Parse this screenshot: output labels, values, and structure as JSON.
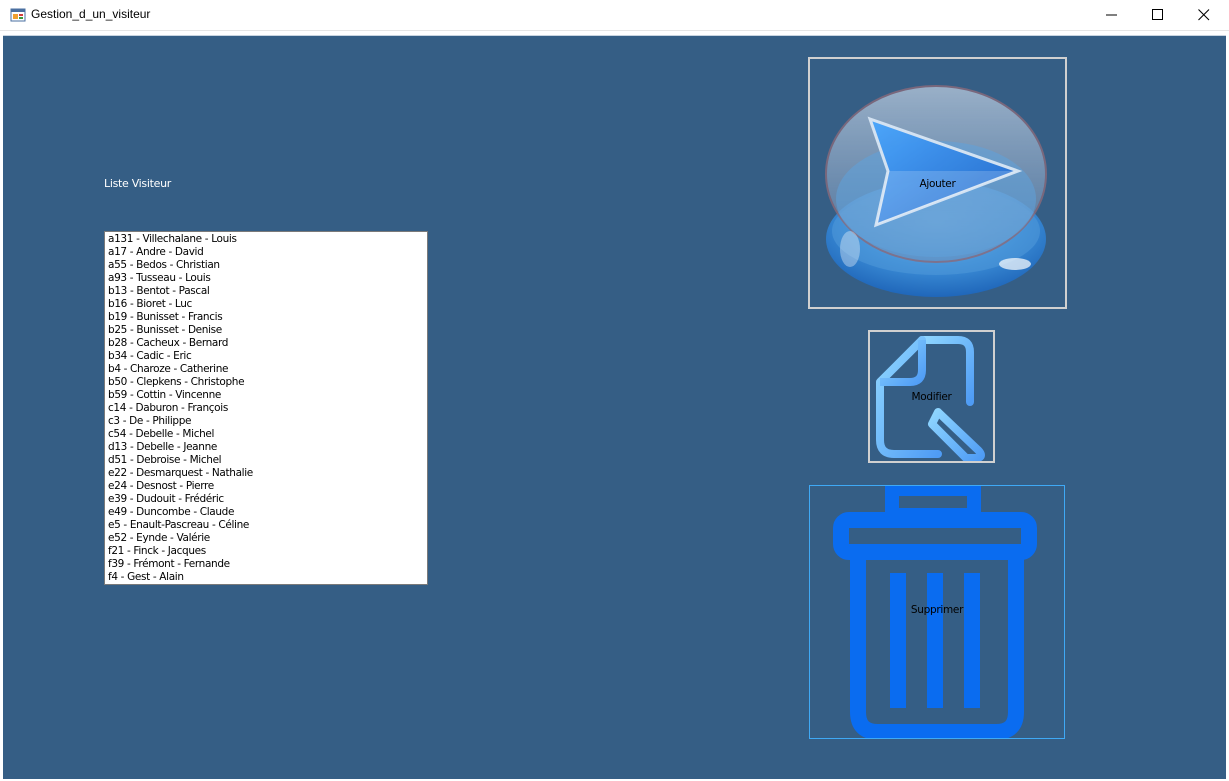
{
  "window": {
    "title": "Gestion_d_un_visiteur",
    "icon": "app-form-icon",
    "controls": [
      "minimize-icon",
      "maximize-icon",
      "close-icon"
    ]
  },
  "form": {
    "list_label": "Liste Visiteur",
    "visitors": [
      "a131 - Villechalane - Louis",
      "a17 - Andre - David",
      "a55 - Bedos - Christian",
      "a93 - Tusseau - Louis",
      "b13 - Bentot - Pascal",
      "b16 - Bioret - Luc",
      "b19 - Bunisset - Francis",
      "b25 - Bunisset - Denise",
      "b28 - Cacheux - Bernard",
      "b34 - Cadic - Eric",
      "b4 - Charoze - Catherine",
      "b50 - Clepkens - Christophe",
      "b59 - Cottin - Vincenne",
      "c14 - Daburon - François",
      "c3 - De - Philippe",
      "c54 - Debelle - Michel",
      "d13 - Debelle - Jeanne",
      "d51 - Debroise - Michel",
      "e22 - Desmarquest - Nathalie",
      "e24 - Desnost - Pierre",
      "e39 - Dudouit - Frédéric",
      "e49 - Duncombe - Claude",
      "e5 - Enault-Pascreau - Céline",
      "e52 - Eynde - Valérie",
      "f21 - Finck - Jacques",
      "f39 - Frémont - Fernande",
      "f4 - Gest - Alain"
    ],
    "buttons": {
      "ajouter": "Ajouter",
      "modifier": "Modifier",
      "supprimer": "Supprimer"
    }
  },
  "colors": {
    "background": "#355e85",
    "trash_blue": "#0a6cf0",
    "edit_icon_blue": "#6ab8ff"
  },
  "icons": {
    "ajouter": "play-arrow-glass-icon",
    "modifier": "edit-document-icon",
    "supprimer": "trash-icon"
  }
}
